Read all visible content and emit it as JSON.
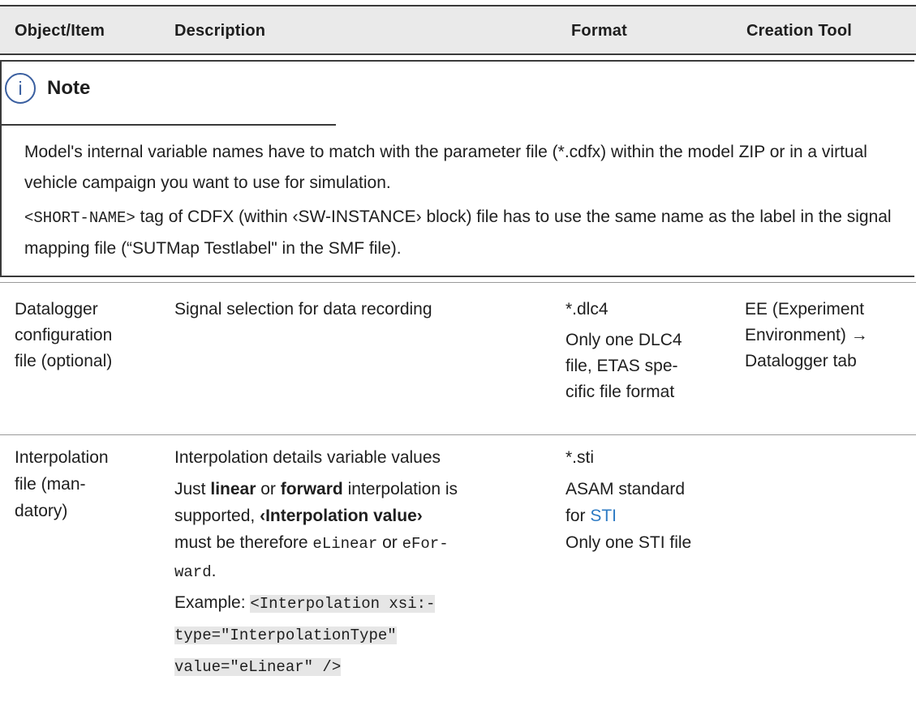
{
  "table_header": {
    "col_object": "Object/Item",
    "col_description": "Description",
    "col_format": "Format",
    "col_tool": "Creation Tool"
  },
  "note": {
    "icon_glyph": "i",
    "title": "Note",
    "para1": "Model's internal variable names have to match with the parameter file (*.cdfx) within the model ZIP or in a virtual vehicle campaign you want to use for simulation.",
    "para2_code1": "<SHORT-NAME>",
    "para2_text1": " tag of CDFX (within ‹SW-INSTANCE› block) file has to use the same name as the label in the signal mapping file (“SUTMap Testlabel\" in the SMF file)."
  },
  "rows": [
    {
      "object_lines": [
        "Datalogger",
        "configuration",
        "file (optional)"
      ],
      "description": "Signal selection for data recording",
      "format_line1": "*.dlc4",
      "format_lines": [
        "Only one DLC4",
        "file, ETAS spe-",
        "cific file format"
      ],
      "tool_lines": [
        "EE (Experiment",
        "Environment) →",
        "Datalogger tab"
      ]
    },
    {
      "object_lines": [
        "Interpolation",
        "file (man-",
        "datory)"
      ],
      "desc_line1": "Interpolation details variable values",
      "desc_just": "Just ",
      "desc_linear": "linear",
      "desc_or": " or ",
      "desc_forward": "forward",
      "desc_supported": " interpolation is",
      "desc_supported2": "supported, ",
      "desc_interp_value": "‹Interpolation value›",
      "desc_must": "must be therefore ",
      "desc_elinear": "eLinear",
      "desc_or2": " or ",
      "desc_efor": "eFor-",
      "desc_ward": "ward",
      "desc_period": ".",
      "desc_example": "Example: ",
      "desc_code1": "<Interpolation xsi:-",
      "desc_code2": "type=\"InterpolationType\"",
      "desc_code3": "value=\"eLinear\" />",
      "format_line1": "*.sti",
      "format_asam1": "ASAM standard",
      "format_for": "for ",
      "format_sti_link": "STI",
      "format_only": "Only one STI file"
    }
  ],
  "colors": {
    "accent": "#3a5fa0",
    "link": "#2e7bc4",
    "header_bg": "#eaeaea"
  }
}
